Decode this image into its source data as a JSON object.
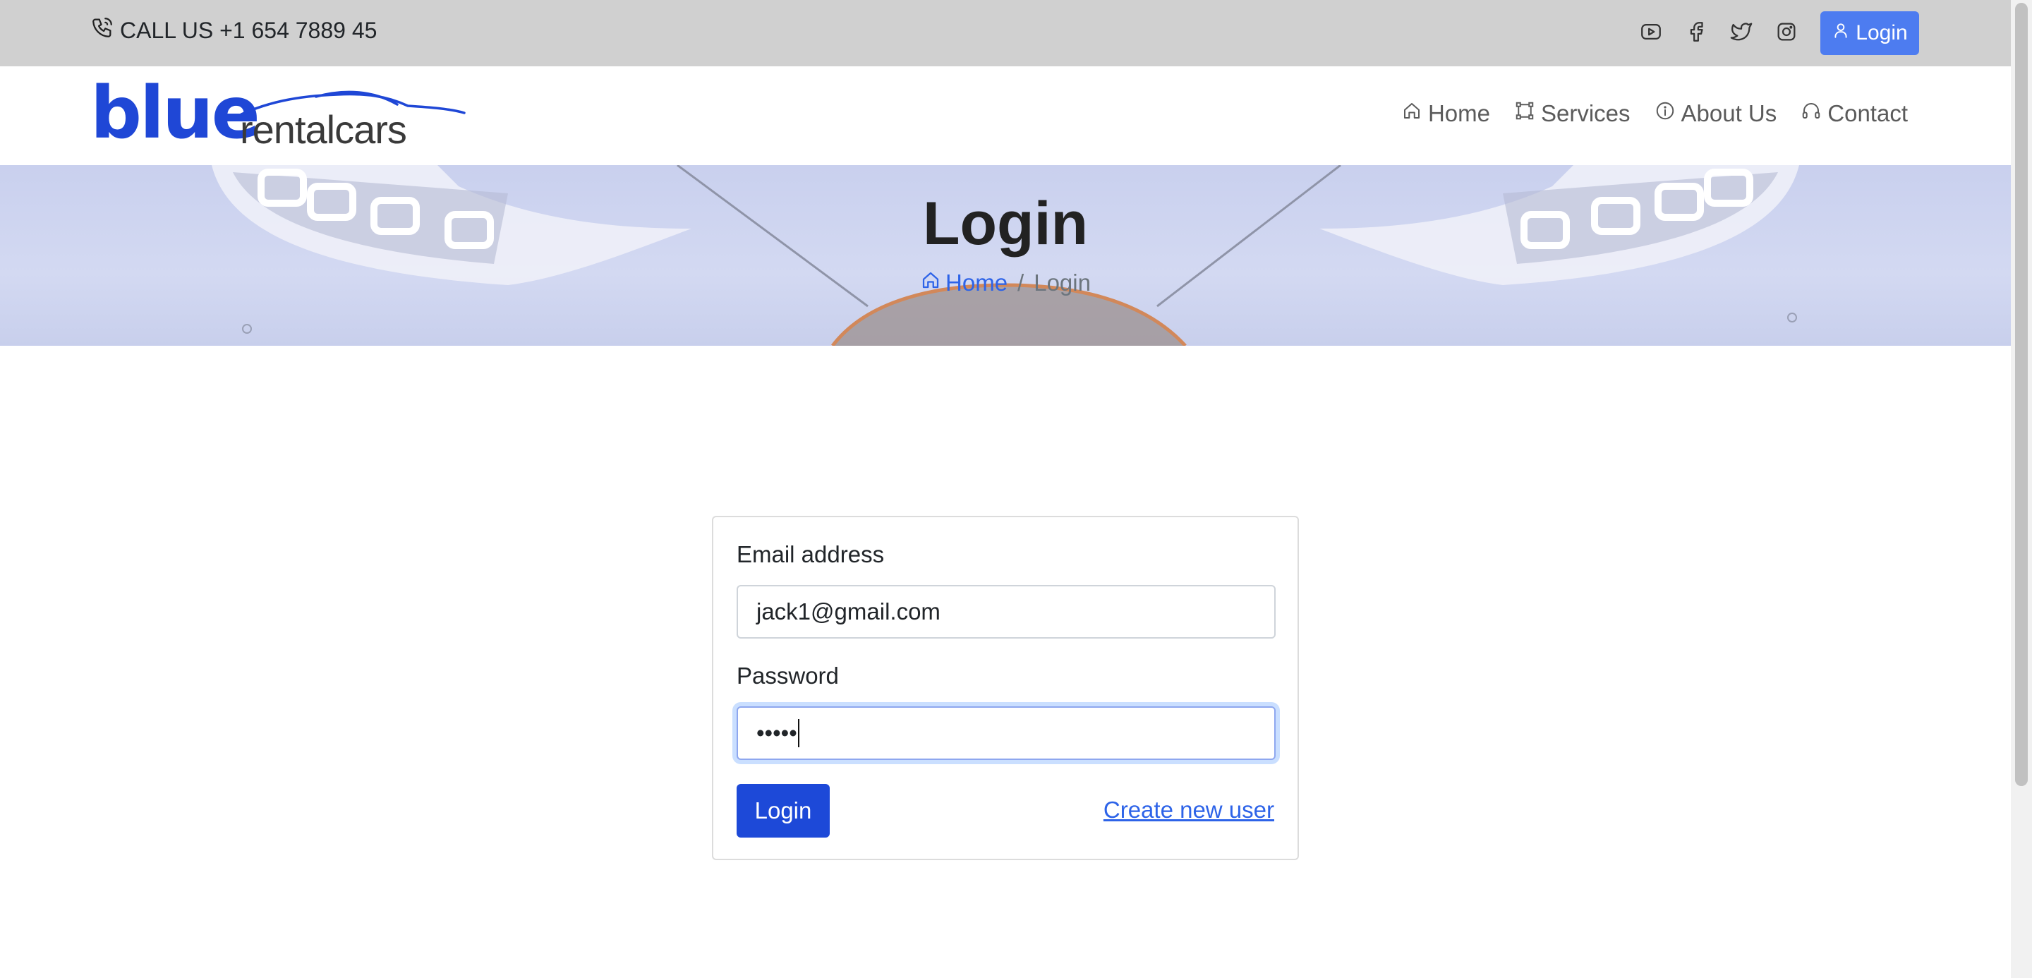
{
  "topbar": {
    "call_text": "CALL US +1 654 7889 45",
    "social_icons": [
      "youtube-icon",
      "facebook-icon",
      "twitter-icon",
      "instagram-icon"
    ],
    "login_label": "Login"
  },
  "brand": {
    "logo_word_1": "blue",
    "logo_word_2": "rentalcars",
    "brand_color": "#1f47d6"
  },
  "nav": {
    "items": [
      {
        "label": "Home",
        "icon": "home-icon"
      },
      {
        "label": "Services",
        "icon": "services-icon"
      },
      {
        "label": "About Us",
        "icon": "info-icon"
      },
      {
        "label": "Contact",
        "icon": "headset-icon"
      }
    ]
  },
  "hero": {
    "title": "Login",
    "breadcrumb": {
      "home": "Home",
      "separator": "/",
      "current": "Login"
    }
  },
  "form": {
    "email_label": "Email address",
    "email_value": "jack1@gmail.com",
    "password_label": "Password",
    "password_value": "•••••",
    "submit_label": "Login",
    "create_link": "Create new user"
  },
  "colors": {
    "primary": "#1d49d8",
    "link": "#2d63e8",
    "topbar_bg": "#d0d0d0"
  }
}
